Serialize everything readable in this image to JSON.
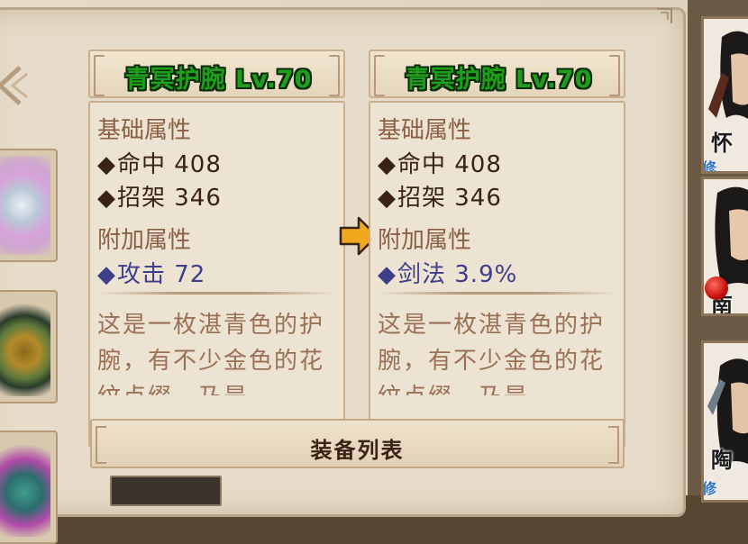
{
  "left_card": {
    "title": "青冥护腕 Lv.70",
    "base_section": "基础属性",
    "base_attrs": [
      {
        "text": "命中  408"
      },
      {
        "text": "招架  346"
      }
    ],
    "extra_section": "附加属性",
    "extra_attrs": [
      {
        "text": "攻击  72"
      }
    ],
    "description": "这是一枚湛青色的护腕，有不少金色的花纹点缀，乃是"
  },
  "right_card": {
    "title": "青冥护腕 Lv.70",
    "base_section": "基础属性",
    "base_attrs": [
      {
        "text": "命中  408"
      },
      {
        "text": "招架  346"
      }
    ],
    "extra_section": "附加属性",
    "extra_attrs": [
      {
        "text": "剑法  3.9%"
      }
    ],
    "description": "这是一枚湛青色的护腕，有不少金色的花纹点缀，乃是"
  },
  "diamond_glyph": "◆",
  "equipment_list": {
    "title": "装备列表"
  },
  "characters": [
    {
      "name": "怀",
      "tag": "修"
    },
    {
      "name": "南",
      "tag": ""
    },
    {
      "name": "陶",
      "tag": "修"
    }
  ],
  "colors": {
    "title_green": "#1f9e1c",
    "attr_blue": "#3e3e8a",
    "arrow_orange": "#f2a81c"
  }
}
